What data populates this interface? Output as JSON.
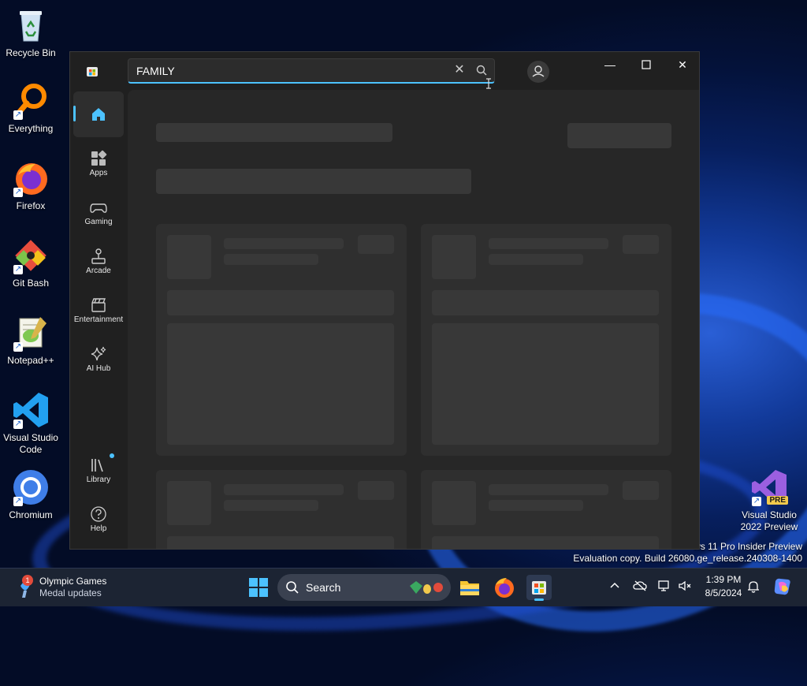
{
  "desktop": {
    "icons": [
      {
        "label": "Recycle Bin"
      },
      {
        "label": "Everything"
      },
      {
        "label": "Firefox"
      },
      {
        "label": "Git Bash"
      },
      {
        "label": "Notepad++"
      },
      {
        "label": "Visual Studio Code"
      },
      {
        "label": "Chromium"
      },
      {
        "label": "Visual Studio 2022 Preview"
      }
    ],
    "watermark_line1": "ws 11 Pro Insider Preview",
    "watermark_line2": "Evaluation copy. Build 26080.ge_release.240308-1400",
    "vs_badge": "PRE"
  },
  "store": {
    "search_value": "FAMILY",
    "nav": [
      {
        "label": ""
      },
      {
        "label": "Apps"
      },
      {
        "label": "Gaming"
      },
      {
        "label": "Arcade"
      },
      {
        "label": "Entertainment"
      },
      {
        "label": "AI Hub"
      },
      {
        "label": "Library"
      },
      {
        "label": "Help"
      }
    ],
    "accent": "#4cc2ff"
  },
  "taskbar": {
    "widget_title": "Olympic Games",
    "widget_subtitle": "Medal updates",
    "widget_badge": "1",
    "search_label": "Search",
    "time": "1:39 PM",
    "date": "8/5/2024"
  }
}
